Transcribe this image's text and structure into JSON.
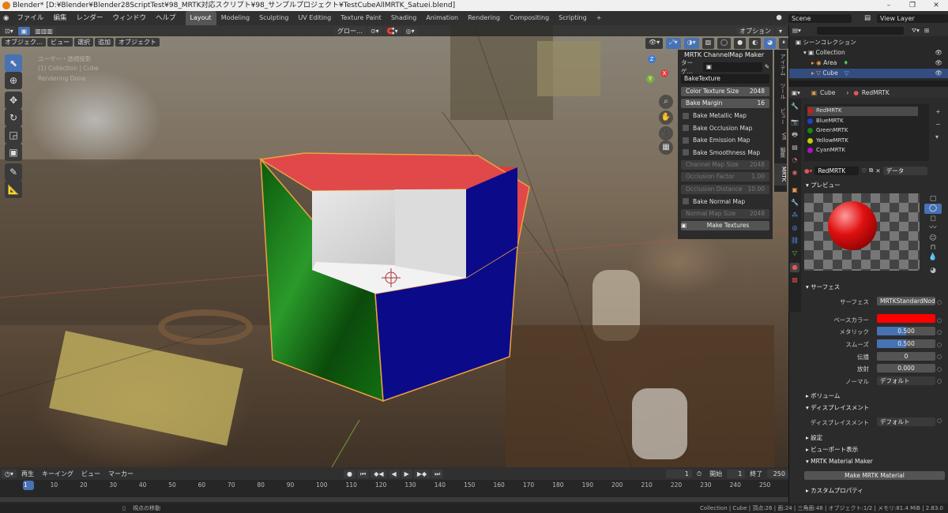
{
  "window": {
    "title": "Blender* [D:¥Blender¥Blender28ScriptTest¥98_MRTK対応スクリプト¥98_サンプルプロジェクト¥TestCubeAllMRTK_Satuei.blend]"
  },
  "menu": {
    "items": [
      "ファイル",
      "編集",
      "レンダー",
      "ウィンドウ",
      "ヘルプ"
    ]
  },
  "workspaces": [
    "Layout",
    "Modeling",
    "Sculpting",
    "UV Editing",
    "Texture Paint",
    "Shading",
    "Animation",
    "Rendering",
    "Compositing",
    "Scripting"
  ],
  "scene": {
    "name": "Scene",
    "view_layer": "View Layer"
  },
  "viewport": {
    "header": {
      "mode": "オブジェク…",
      "view": "ビュー",
      "select": "選択",
      "add": "追加",
      "object": "オブジェクト",
      "transform": "グロー…",
      "options": "オプション"
    },
    "overlay": {
      "line1": "ユーザー・透視投影",
      "line2": "(1) Collection | Cube",
      "line3": "Rendering Done"
    },
    "gizmo": {
      "z": "Z",
      "y": "Y",
      "x": "X"
    }
  },
  "npanel": {
    "title": "MRTK ChannelMap Maker",
    "target_label": "ターゲ…",
    "bake_name": "BakeTexture",
    "color_texture_size": {
      "label": "Color Texture Size",
      "value": "2048"
    },
    "bake_margin": {
      "label": "Bake Margin",
      "value": "16"
    },
    "checks": [
      "Bake Metallic Map",
      "Bake Occlusion Map",
      "Bake Emission Map",
      "Bake Smoothness Map"
    ],
    "channel_map_size": {
      "label": "Channel Map Size",
      "value": "2048"
    },
    "occlusion_factor": {
      "label": "Occlusion Factor",
      "value": "1.00"
    },
    "occlusion_distance": {
      "label": "Occlusion Distance",
      "value": "10.00"
    },
    "bake_normal": "Bake Normal Map",
    "normal_map_size": {
      "label": "Normal Map Size",
      "value": "2048"
    },
    "make_button": "Make Textures",
    "tabs": [
      "アイテム",
      "ツール",
      "ビュー",
      "VR",
      "編集",
      "MRTK"
    ]
  },
  "timeline": {
    "menu": [
      "再生",
      "キーイング",
      "ビュー",
      "マーカー"
    ],
    "current_frame": "1",
    "start_label": "開始",
    "start": "1",
    "end_label": "終了",
    "end": "250",
    "ticks": [
      "1",
      "10",
      "20",
      "30",
      "40",
      "50",
      "60",
      "70",
      "80",
      "90",
      "100",
      "110",
      "120",
      "130",
      "140",
      "150",
      "160",
      "170",
      "180",
      "190",
      "200",
      "210",
      "220",
      "230",
      "240",
      "250"
    ]
  },
  "status": {
    "left": "視点の移動",
    "right": "Collection | Cube | 頂点:26 | 面:24 | 三角面:48 | オブジェクト:1/2 | メモリ:81.4 MiB | 2.83.0"
  },
  "outliner": {
    "root": "シーンコレクション",
    "collection": "Collection",
    "items": [
      "Area",
      "Cube"
    ]
  },
  "properties": {
    "object": "Cube",
    "material": "RedMRTK",
    "materials": [
      {
        "name": "RedMRTK",
        "color": "#d81818"
      },
      {
        "name": "BlueMRTK",
        "color": "#1f3fd0"
      },
      {
        "name": "GreenMRTK",
        "color": "#138a13"
      },
      {
        "name": "YellowMRTK",
        "color": "#c8c814"
      },
      {
        "name": "CyanMRTK",
        "color": "#b010c8"
      }
    ],
    "slot_material": "RedMRTK",
    "data_label": "データ",
    "preview_header": "プレビュー",
    "surface_header": "サーフェス",
    "surface": {
      "label": "サーフェス",
      "value": "MRTKStandardNode…"
    },
    "base_color": {
      "label": "ベースカラー",
      "color": "#ff0000"
    },
    "metallic": {
      "label": "メタリック",
      "value": "0.500",
      "fill": 0.5
    },
    "smoothness": {
      "label": "スムーズ",
      "value": "0.500",
      "fill": 0.5
    },
    "transmission": {
      "label": "伝播",
      "value": "0"
    },
    "emission": {
      "label": "放射",
      "value": "0.000"
    },
    "normal": {
      "label": "ノーマル",
      "value": "デフォルト"
    },
    "volume": "ボリューム",
    "displacement_header": "ディスプレイスメント",
    "displacement": {
      "label": "ディスプレイスメント",
      "value": "デフォルト"
    },
    "settings": "設定",
    "viewport_display": "ビューポート表示",
    "mrtk_maker": "MRTK Material Maker",
    "make_button": "Make MRTK Material",
    "custom_props": "カスタムプロパティ"
  }
}
